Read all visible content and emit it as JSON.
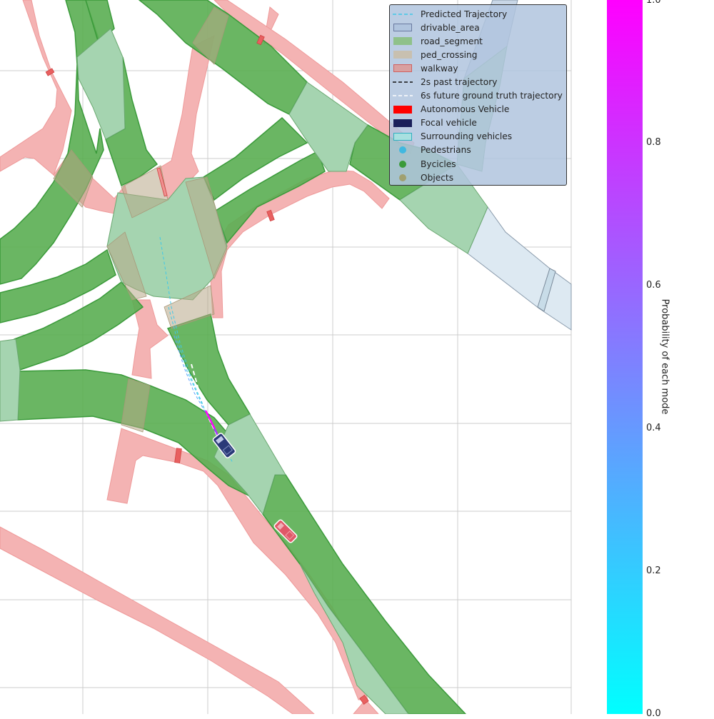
{
  "legend": {
    "items": [
      {
        "label": "Predicted Trajectory",
        "symbol": "dash-line",
        "color": "#40c8e8"
      },
      {
        "label": "drivable_area",
        "symbol": "patch",
        "color": "#b0c4de",
        "edge": "#6a7aa0"
      },
      {
        "label": "road_segment",
        "symbol": "patch",
        "color": "#8fc18a",
        "edge": "#8fc18a"
      },
      {
        "label": "ped_crossing",
        "symbol": "patch",
        "color": "#c8c0b0",
        "edge": "#c8c0b0"
      },
      {
        "label": "walkway",
        "symbol": "patch",
        "color": "#d9a0a0",
        "edge": "#d06060"
      },
      {
        "label": "2s past trajectory",
        "symbol": "dash-line",
        "color": "#111111"
      },
      {
        "label": "6s future ground truth trajectory",
        "symbol": "dash-line",
        "color": "#ffffff"
      },
      {
        "label": "Autonomous Vehicle",
        "symbol": "patch",
        "color": "#ff0000",
        "edge": "#ff0000"
      },
      {
        "label": "Focal vehicle",
        "symbol": "patch",
        "color": "#1a1f5a",
        "edge": "#1a1f5a"
      },
      {
        "label": "Surrounding vehicles",
        "symbol": "patch",
        "color": "#a8e0e0",
        "edge": "#30b0c0"
      },
      {
        "label": "Pedestrians",
        "symbol": "dot",
        "color": "#40b8e0"
      },
      {
        "label": "Bycicles",
        "symbol": "dot",
        "color": "#3a9a3a"
      },
      {
        "label": "Objects",
        "symbol": "dot",
        "color": "#a0a070"
      }
    ]
  },
  "colorbar": {
    "label": "Probability of each mode",
    "ticks": [
      "0.0",
      "0.2",
      "0.4",
      "0.6",
      "0.8",
      "1.0"
    ],
    "colors": {
      "low": "#00ffff",
      "high": "#ff00ff"
    }
  },
  "colors": {
    "road_segment": "#5aae52",
    "lane": "#a5d4b0",
    "walkway": "#f4b3b3",
    "drivable_light": "#dde9f2",
    "grid": "#cccccc"
  }
}
